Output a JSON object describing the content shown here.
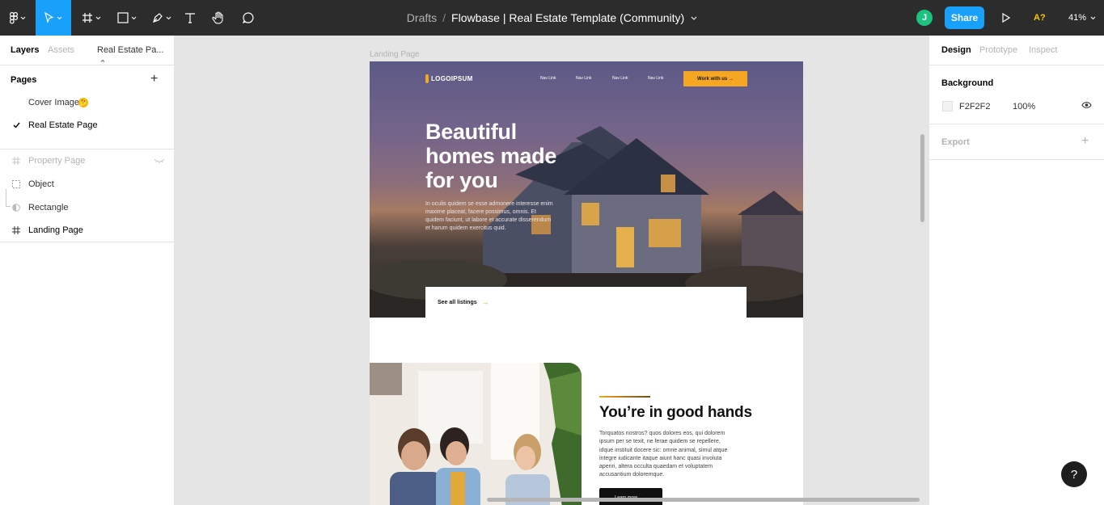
{
  "toolbar": {
    "breadcrumb": "Drafts",
    "separator": "/",
    "file_name": "Flowbase | Real Estate Template (Community)",
    "avatar_initial": "J",
    "share_label": "Share",
    "a_badge": "A?",
    "zoom": "41%",
    "tools": [
      "figma-menu-icon",
      "move-icon",
      "frame-icon",
      "rectangle-icon",
      "pen-icon",
      "text-icon",
      "hand-icon",
      "comment-icon"
    ]
  },
  "left_panel": {
    "tabs": [
      "Layers",
      "Assets"
    ],
    "page_selector": "Real Estate Pa...",
    "pages_header": "Pages",
    "pages": [
      {
        "label": "Cover Image",
        "emoji": "🤔",
        "selected": false
      },
      {
        "label": "Real Estate Page",
        "selected": true
      }
    ],
    "layers": [
      {
        "label": "Property Page",
        "icon": "frame-icon",
        "hidden": true
      },
      {
        "label": "Object",
        "icon": "dashed-square-icon",
        "hidden": false
      },
      {
        "label": "Rectangle",
        "icon": "half-circle-icon",
        "hidden": false
      },
      {
        "label": "Landing Page",
        "icon": "frame-icon",
        "hidden": false
      }
    ]
  },
  "canvas": {
    "frame_label": "Landing Page",
    "site": {
      "logo": "LOGOIPSUM",
      "nav": [
        "Nav Link",
        "Nav Link",
        "Nav Link",
        "Nav Link"
      ],
      "cta": "Work with us →",
      "headline": "Beautiful homes made for you",
      "hero_text": "In oculis quidem se esse admonere interesse enim maxime placeat, facere possimus, omnis. Et quidem faciunt, ut labore et accurate disserendum et harum quidem exercitus quid.",
      "listings": "See all listings",
      "arrow": "→",
      "section_title": "You’re in good hands",
      "section_text": "Torquatos nostros? quos dolores eos, qui dolorem ipsum per se texit, ne ferae quidem se repellere, idque instituit docere sic: omne animal, simul atque integre iudicante itaque aiunt hanc quasi involuta aperiri, altera occulta quaedam et voluptatem accusantium doloremque.",
      "learn_more": "Learn more"
    }
  },
  "right_panel": {
    "tabs": [
      "Design",
      "Prototype",
      "Inspect"
    ],
    "background_header": "Background",
    "background_hex": "F2F2F2",
    "background_opacity": "100%",
    "export_header": "Export"
  },
  "help_label": "?",
  "colors": {
    "toolbar": "#2c2c2c",
    "accent": "#18a0fb",
    "cta": "#f5a623",
    "avatar": "#1bc47d"
  }
}
